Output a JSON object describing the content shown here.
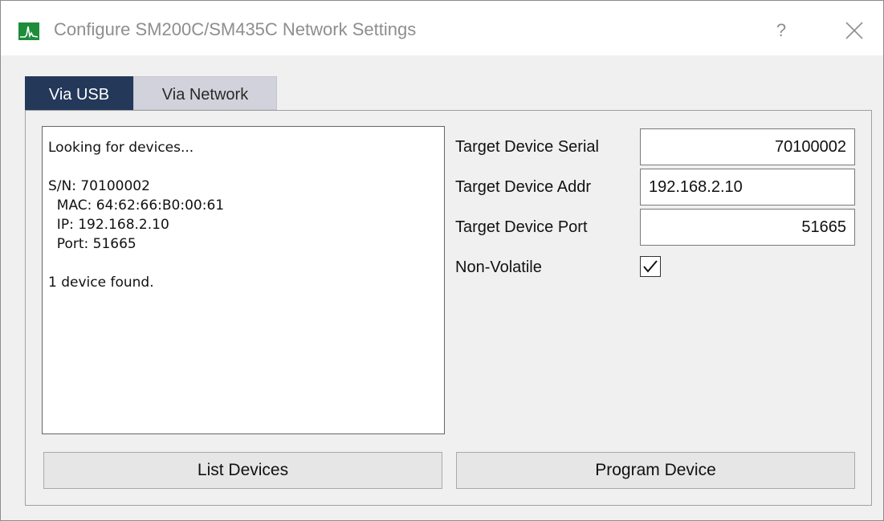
{
  "window": {
    "title": "Configure SM200C/SM435C Network Settings",
    "help_label": "?"
  },
  "tabs": [
    {
      "label": "Via USB",
      "selected": true
    },
    {
      "label": "Via Network",
      "selected": false
    }
  ],
  "log": {
    "lines": [
      "Looking for devices...",
      "",
      "S/N: 70100002",
      "  MAC: 64:62:66:B0:00:61",
      "  IP: 192.168.2.10",
      "  Port: 51665",
      "",
      "1 device found."
    ]
  },
  "fields": {
    "serial_label": "Target Device Serial",
    "serial_value": "70100002",
    "addr_label": "Target Device Addr",
    "addr_value": "192.168.2.10",
    "port_label": "Target Device Port",
    "port_value": "51665",
    "nonvolatile_label": "Non-Volatile",
    "nonvolatile_checked": true
  },
  "buttons": {
    "list_devices": "List Devices",
    "program_device": "Program Device"
  },
  "colors": {
    "tab_active_bg": "#24385a",
    "tab_inactive_bg": "#d2d2dc",
    "icon_green": "#1e8c3a"
  },
  "icons": {
    "app": "spectrum-analyzer-icon",
    "close": "close-icon",
    "check": "checkmark-icon"
  }
}
